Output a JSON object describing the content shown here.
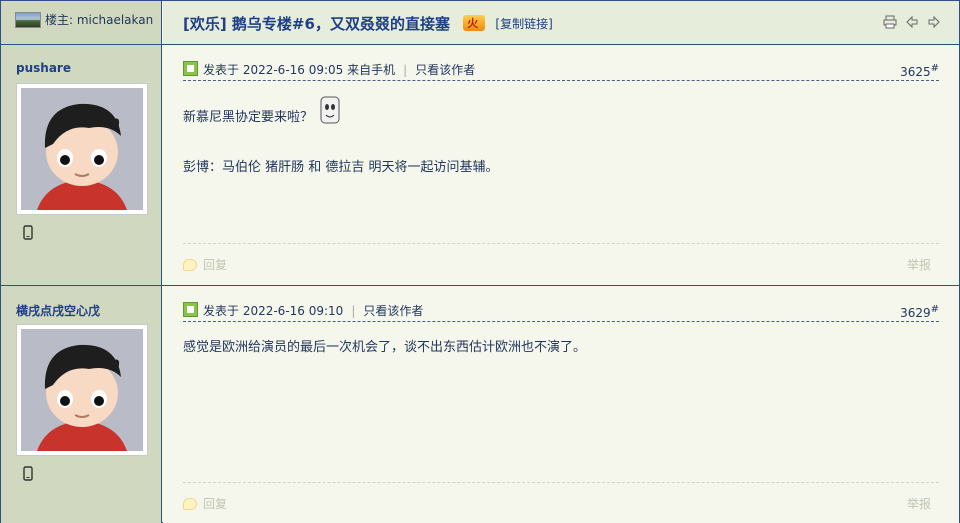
{
  "header": {
    "owner_label": "楼主: michaelakan",
    "title": "[欢乐] 鹅乌专楼#6，又双叒叕的直接塞",
    "hot_badge": "火",
    "copy_link": "[复制链接]",
    "tool_icons": [
      "print-icon",
      "arrow-left-icon",
      "arrow-right-icon"
    ]
  },
  "posts": [
    {
      "username": "pushare",
      "meta_posted": "发表于 2022-6-16 09:05 来自手机",
      "only_author": "只看该作者",
      "floor_number": "3625",
      "floor_mark": "#",
      "lines": [
        "新慕尼黑协定要来啦？",
        "彭博：马伯伦 猪肝肠 和 德拉吉 明天将一起访问基辅。"
      ],
      "reply": "回复",
      "report": "举报"
    },
    {
      "username": "横戌点戌空心戊",
      "meta_posted": "发表于 2022-6-16 09:10",
      "only_author": "只看该作者",
      "floor_number": "3629",
      "floor_mark": "#",
      "lines": [
        "感觉是欧洲给演员的最后一次机会了，谈不出东西估计欧洲也不演了。"
      ],
      "reply": "回复",
      "report": "举报"
    }
  ],
  "colors": {
    "border": "#2f4f89",
    "left_panel": "#d0d9bf",
    "post_bg": "#f6f7ec",
    "header_bg": "#e6eddb",
    "title": "#1f3f86"
  }
}
